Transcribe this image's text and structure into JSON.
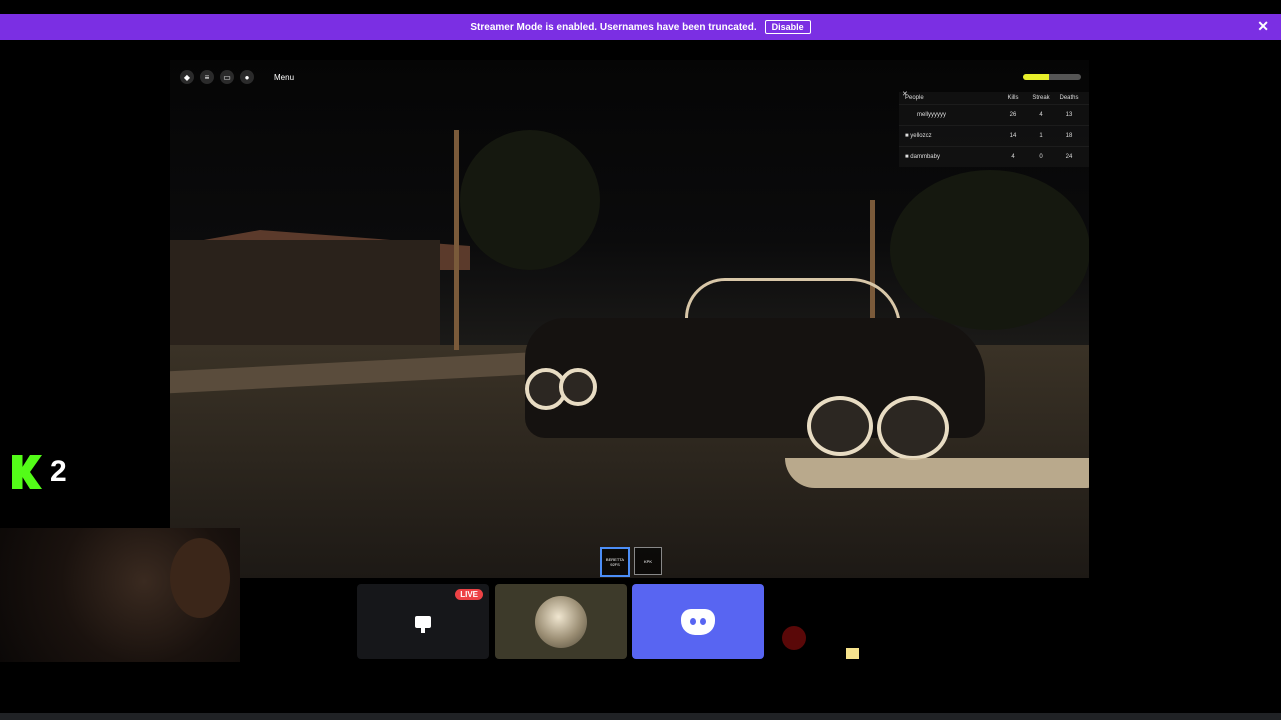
{
  "banner": {
    "message": "Streamer Mode is enabled. Usernames have been truncated.",
    "button": "Disable",
    "close_icon": "✕"
  },
  "game": {
    "menu_label": "Menu",
    "health_fraction": 0.45,
    "leaderboard": {
      "close_icon": "✕",
      "headers": [
        "People",
        "Kills",
        "Streak",
        "Deaths"
      ],
      "rows": [
        {
          "name": "mellyyyyyy",
          "kills": "26",
          "streak": "4",
          "deaths": "13"
        },
        {
          "name": "yellozcz",
          "kills": "14",
          "streak": "1",
          "deaths": "18"
        },
        {
          "name": "dammbaby",
          "kills": "4",
          "streak": "0",
          "deaths": "24"
        }
      ]
    },
    "hotbar": [
      {
        "label": "BERETTA 92FS",
        "selected": true
      },
      {
        "label": "KPK",
        "selected": false
      }
    ]
  },
  "kick_overlay": {
    "number": "2"
  },
  "tiles": {
    "live_badge": "LIVE"
  },
  "colors": {
    "banner": "#7b2fe3",
    "discord": "#5865f2",
    "kick": "#53fc18",
    "live": "#ed4245"
  }
}
